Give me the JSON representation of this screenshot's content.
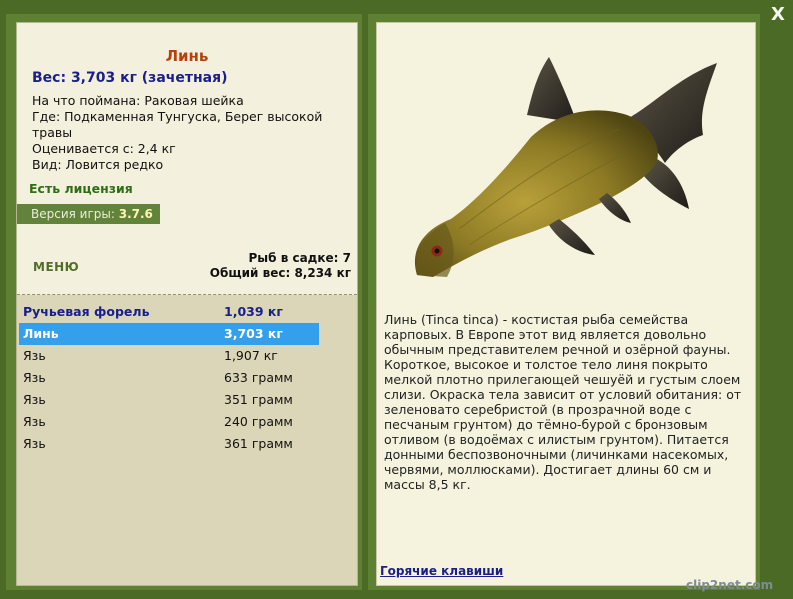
{
  "window": {
    "close_label": "X"
  },
  "fish": {
    "name": "Линь",
    "weight": "Вес: 3,703 кг (зачетная)",
    "caught_on": "На что поймана: Раковая шейка",
    "location_line1": "Где: Подкаменная Тунгуска, Берег высокой",
    "location_line2": "травы",
    "valued_from": "Оценивается с: 2,4 кг",
    "kind": "Вид: Ловится редко"
  },
  "license_status": "Есть лицензия",
  "version": {
    "label": "Версия игры:",
    "value": "3.7.6"
  },
  "menu_label": "МЕНЮ",
  "keepnet": {
    "count": "Рыб в садке: 7",
    "total": "Общий вес: 8,234 кг"
  },
  "catch_list": [
    {
      "name": "Ручьевая форель",
      "weight": "1,039 кг"
    },
    {
      "name": "Линь",
      "weight": "3,703 кг"
    },
    {
      "name": "Язь",
      "weight": "1,907 кг"
    },
    {
      "name": "Язь",
      "weight": "633 грамм"
    },
    {
      "name": "Язь",
      "weight": "351 грамм"
    },
    {
      "name": "Язь",
      "weight": "240 грамм"
    },
    {
      "name": "Язь",
      "weight": "361 грамм"
    }
  ],
  "description": "Линь (Tinca tinca) - костистая рыба семейства карповых. В Европе этот вид является довольно обычным представителем речной и озёрной фауны. Короткое, высокое и толстое тело линя покрыто мелкой плотно прилегающей чешуёй и густым слоем слизи. Окраска тела зависит от условий обитания: от зеленовато серебристой (в прозрачной воде с песчаным грунтом) до тёмно-бурой с бронзовым отливом (в водоёмах с илистым грунтом). Питается донными беспозвоночными (личинками насекомых, червями, моллюсками). Достигает длины 60 см и массы 8,5 кг.",
  "hotkeys_label": "Горячие клавиши",
  "watermark": "clip2net.com",
  "colors": {
    "background": "#4b6a25",
    "selected_row": "#34a0ec",
    "title": "#b4420c",
    "link": "#1a1f8a"
  }
}
